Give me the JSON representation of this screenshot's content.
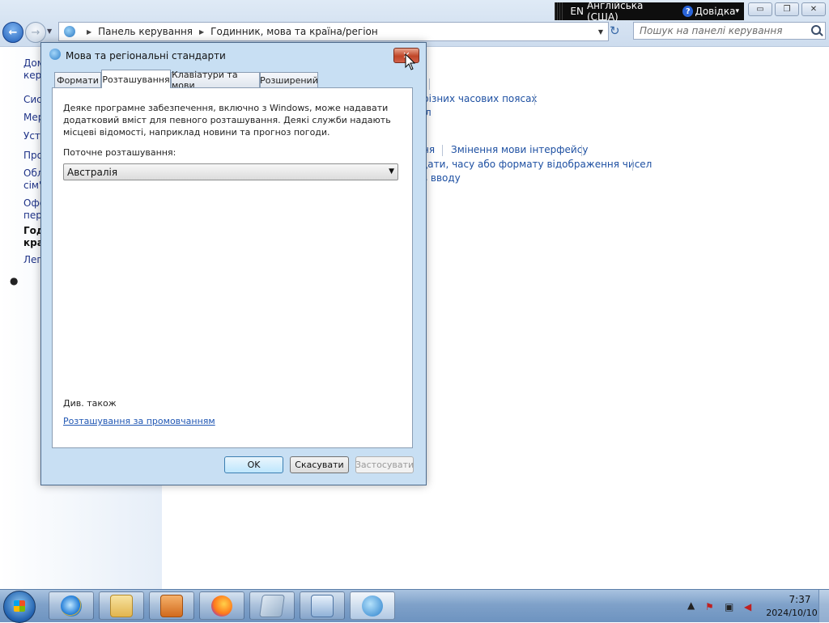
{
  "language_bar": {
    "code": "EN",
    "name": "Англійська (США)",
    "help_label": "Довідка"
  },
  "caption_buttons": {
    "minimize": "▭",
    "maximize": "❐",
    "close": "✕"
  },
  "address_bar": {
    "crumbs": [
      "Панель керування",
      "Годинник, мова та країна/регіон"
    ],
    "search_placeholder": "Пошук на панелі керування"
  },
  "left_pane": {
    "items": [
      "Дом",
      "керу",
      "Сис",
      "Мер",
      "Уста",
      "Про",
      "Обл",
      "сім'",
      "Офо",
      "пер",
      "Год",
      "кра",
      "Лег"
    ]
  },
  "main_links": [
    "різних часових поясах",
    "л",
    "ня",
    "Змінення мови інтерфейсу",
    "дати, часу або формату відображення чисел",
    "в вводу"
  ],
  "dialog": {
    "title": "Мова та регіональні стандарти",
    "tabs": [
      "Формати",
      "Розташування",
      "Клавіатури та мови",
      "Розширений"
    ],
    "active_tab": "Розташування",
    "description": "Деяке програмне забезпечення, включно з Windows, може надавати додатковий вміст для певного розташування. Деякі служби надають місцеві відомості, наприклад новини та прогноз погоди.",
    "location_label": "Поточне розташування:",
    "location_value": "Австралія",
    "see_also": "Див. також",
    "default_location_link": "Розташування за промовчанням",
    "buttons": {
      "ok": "OK",
      "cancel": "Скасувати",
      "apply": "Застосувати"
    }
  },
  "taskbar": {
    "pinned_apps": [
      "internet-explorer",
      "file-explorer",
      "media-player",
      "firefox",
      "app-window",
      "control-panel",
      "region-language"
    ],
    "clock_time": "7:37",
    "clock_date": "2024/10/10"
  }
}
